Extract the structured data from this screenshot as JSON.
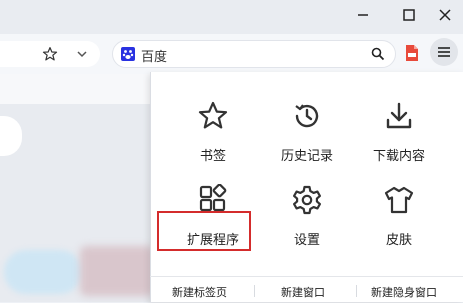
{
  "toolbar": {
    "search_text": "百度"
  },
  "menu": {
    "tiles": [
      {
        "label": "书签",
        "icon": "star-icon"
      },
      {
        "label": "历史记录",
        "icon": "history-icon"
      },
      {
        "label": "下载内容",
        "icon": "download-icon"
      },
      {
        "label": "扩展程序",
        "icon": "extensions-icon"
      },
      {
        "label": "设置",
        "icon": "gear-icon"
      },
      {
        "label": "皮肤",
        "icon": "tshirt-icon"
      }
    ],
    "bottom": [
      {
        "label": "新建标签页"
      },
      {
        "label": "新建窗口"
      },
      {
        "label": "新建隐身窗口"
      }
    ],
    "highlight_color": "#d42c2c"
  }
}
